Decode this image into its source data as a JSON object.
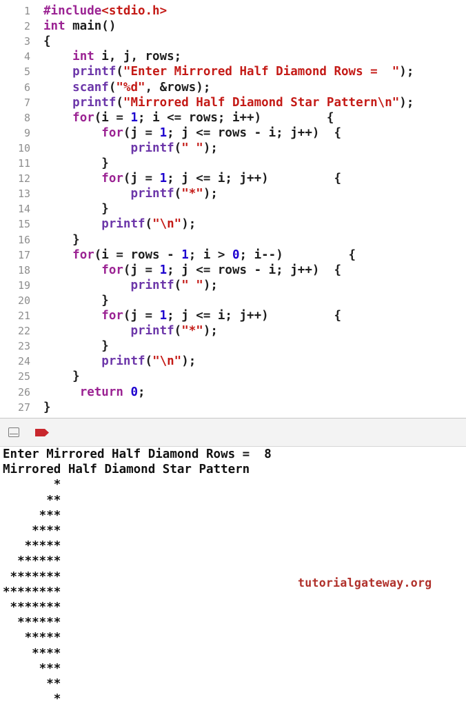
{
  "code": {
    "lines": [
      {
        "n": "1",
        "tokens": [
          {
            "t": "#include",
            "c": "pp"
          },
          {
            "t": "<stdio.h>",
            "c": "str"
          }
        ]
      },
      {
        "n": "2",
        "tokens": [
          {
            "t": "int",
            "c": "kw"
          },
          {
            "t": " main()",
            "c": ""
          }
        ]
      },
      {
        "n": "3",
        "tokens": [
          {
            "t": "{",
            "c": ""
          }
        ]
      },
      {
        "n": "4",
        "tokens": [
          {
            "t": "    ",
            "c": ""
          },
          {
            "t": "int",
            "c": "kw"
          },
          {
            "t": " i, j, rows;",
            "c": ""
          }
        ]
      },
      {
        "n": "5",
        "tokens": [
          {
            "t": "    ",
            "c": ""
          },
          {
            "t": "printf",
            "c": "fn"
          },
          {
            "t": "(",
            "c": ""
          },
          {
            "t": "\"Enter Mirrored Half Diamond Rows =  \"",
            "c": "str"
          },
          {
            "t": ");",
            "c": ""
          }
        ]
      },
      {
        "n": "6",
        "tokens": [
          {
            "t": "    ",
            "c": ""
          },
          {
            "t": "scanf",
            "c": "fn"
          },
          {
            "t": "(",
            "c": ""
          },
          {
            "t": "\"%d\"",
            "c": "str"
          },
          {
            "t": ", &rows);",
            "c": ""
          }
        ]
      },
      {
        "n": "7",
        "tokens": [
          {
            "t": "    ",
            "c": ""
          },
          {
            "t": "printf",
            "c": "fn"
          },
          {
            "t": "(",
            "c": ""
          },
          {
            "t": "\"Mirrored Half Diamond Star Pattern\\n\"",
            "c": "str"
          },
          {
            "t": ");",
            "c": ""
          }
        ]
      },
      {
        "n": "8",
        "tokens": [
          {
            "t": "    ",
            "c": ""
          },
          {
            "t": "for",
            "c": "kw"
          },
          {
            "t": "(i = ",
            "c": ""
          },
          {
            "t": "1",
            "c": "num"
          },
          {
            "t": "; i <= rows; i++)         {",
            "c": ""
          }
        ]
      },
      {
        "n": "9",
        "tokens": [
          {
            "t": "        ",
            "c": ""
          },
          {
            "t": "for",
            "c": "kw"
          },
          {
            "t": "(j = ",
            "c": ""
          },
          {
            "t": "1",
            "c": "num"
          },
          {
            "t": "; j <= rows - i; j++)  {",
            "c": ""
          }
        ]
      },
      {
        "n": "10",
        "tokens": [
          {
            "t": "            ",
            "c": ""
          },
          {
            "t": "printf",
            "c": "fn"
          },
          {
            "t": "(",
            "c": ""
          },
          {
            "t": "\" \"",
            "c": "str"
          },
          {
            "t": ");",
            "c": ""
          }
        ]
      },
      {
        "n": "11",
        "tokens": [
          {
            "t": "        }",
            "c": ""
          }
        ]
      },
      {
        "n": "12",
        "tokens": [
          {
            "t": "        ",
            "c": ""
          },
          {
            "t": "for",
            "c": "kw"
          },
          {
            "t": "(j = ",
            "c": ""
          },
          {
            "t": "1",
            "c": "num"
          },
          {
            "t": "; j <= i; j++)         {",
            "c": ""
          }
        ]
      },
      {
        "n": "13",
        "tokens": [
          {
            "t": "            ",
            "c": ""
          },
          {
            "t": "printf",
            "c": "fn"
          },
          {
            "t": "(",
            "c": ""
          },
          {
            "t": "\"*\"",
            "c": "str"
          },
          {
            "t": ");",
            "c": ""
          }
        ]
      },
      {
        "n": "14",
        "tokens": [
          {
            "t": "        }",
            "c": ""
          }
        ]
      },
      {
        "n": "15",
        "tokens": [
          {
            "t": "        ",
            "c": ""
          },
          {
            "t": "printf",
            "c": "fn"
          },
          {
            "t": "(",
            "c": ""
          },
          {
            "t": "\"\\n\"",
            "c": "str"
          },
          {
            "t": ");",
            "c": ""
          }
        ]
      },
      {
        "n": "16",
        "tokens": [
          {
            "t": "    }",
            "c": ""
          }
        ]
      },
      {
        "n": "17",
        "tokens": [
          {
            "t": "    ",
            "c": ""
          },
          {
            "t": "for",
            "c": "kw"
          },
          {
            "t": "(i = rows - ",
            "c": ""
          },
          {
            "t": "1",
            "c": "num"
          },
          {
            "t": "; i > ",
            "c": ""
          },
          {
            "t": "0",
            "c": "num"
          },
          {
            "t": "; i--)         {",
            "c": ""
          }
        ]
      },
      {
        "n": "18",
        "tokens": [
          {
            "t": "        ",
            "c": ""
          },
          {
            "t": "for",
            "c": "kw"
          },
          {
            "t": "(j = ",
            "c": ""
          },
          {
            "t": "1",
            "c": "num"
          },
          {
            "t": "; j <= rows - i; j++)  {",
            "c": ""
          }
        ]
      },
      {
        "n": "19",
        "tokens": [
          {
            "t": "            ",
            "c": ""
          },
          {
            "t": "printf",
            "c": "fn"
          },
          {
            "t": "(",
            "c": ""
          },
          {
            "t": "\" \"",
            "c": "str"
          },
          {
            "t": ");",
            "c": ""
          }
        ]
      },
      {
        "n": "20",
        "tokens": [
          {
            "t": "        }",
            "c": ""
          }
        ]
      },
      {
        "n": "21",
        "tokens": [
          {
            "t": "        ",
            "c": ""
          },
          {
            "t": "for",
            "c": "kw"
          },
          {
            "t": "(j = ",
            "c": ""
          },
          {
            "t": "1",
            "c": "num"
          },
          {
            "t": "; j <= i; j++)         {",
            "c": ""
          }
        ]
      },
      {
        "n": "22",
        "tokens": [
          {
            "t": "            ",
            "c": ""
          },
          {
            "t": "printf",
            "c": "fn"
          },
          {
            "t": "(",
            "c": ""
          },
          {
            "t": "\"*\"",
            "c": "str"
          },
          {
            "t": ");",
            "c": ""
          }
        ]
      },
      {
        "n": "23",
        "tokens": [
          {
            "t": "        }",
            "c": ""
          }
        ]
      },
      {
        "n": "24",
        "tokens": [
          {
            "t": "        ",
            "c": ""
          },
          {
            "t": "printf",
            "c": "fn"
          },
          {
            "t": "(",
            "c": ""
          },
          {
            "t": "\"\\n\"",
            "c": "str"
          },
          {
            "t": ");",
            "c": ""
          }
        ]
      },
      {
        "n": "25",
        "tokens": [
          {
            "t": "    }",
            "c": ""
          }
        ]
      },
      {
        "n": "26",
        "tokens": [
          {
            "t": "     ",
            "c": ""
          },
          {
            "t": "return",
            "c": "kw"
          },
          {
            "t": " ",
            "c": ""
          },
          {
            "t": "0",
            "c": "num"
          },
          {
            "t": ";",
            "c": ""
          }
        ]
      },
      {
        "n": "27",
        "tokens": [
          {
            "t": "}",
            "c": ""
          }
        ]
      }
    ]
  },
  "debug_bar": {
    "icons": [
      "hide-debug-area-icon",
      "breakpoint-icon"
    ],
    "breakpoint_color": "#c8272d"
  },
  "console": {
    "lines": [
      "Enter Mirrored Half Diamond Rows =  8",
      "Mirrored Half Diamond Star Pattern",
      "       *",
      "      **",
      "     ***",
      "    ****",
      "   *****",
      "  ******",
      " *******",
      "********",
      " *******",
      "  ******",
      "   *****",
      "    ****",
      "     ***",
      "      **",
      "       *"
    ],
    "watermark": "tutorialgateway.org"
  }
}
